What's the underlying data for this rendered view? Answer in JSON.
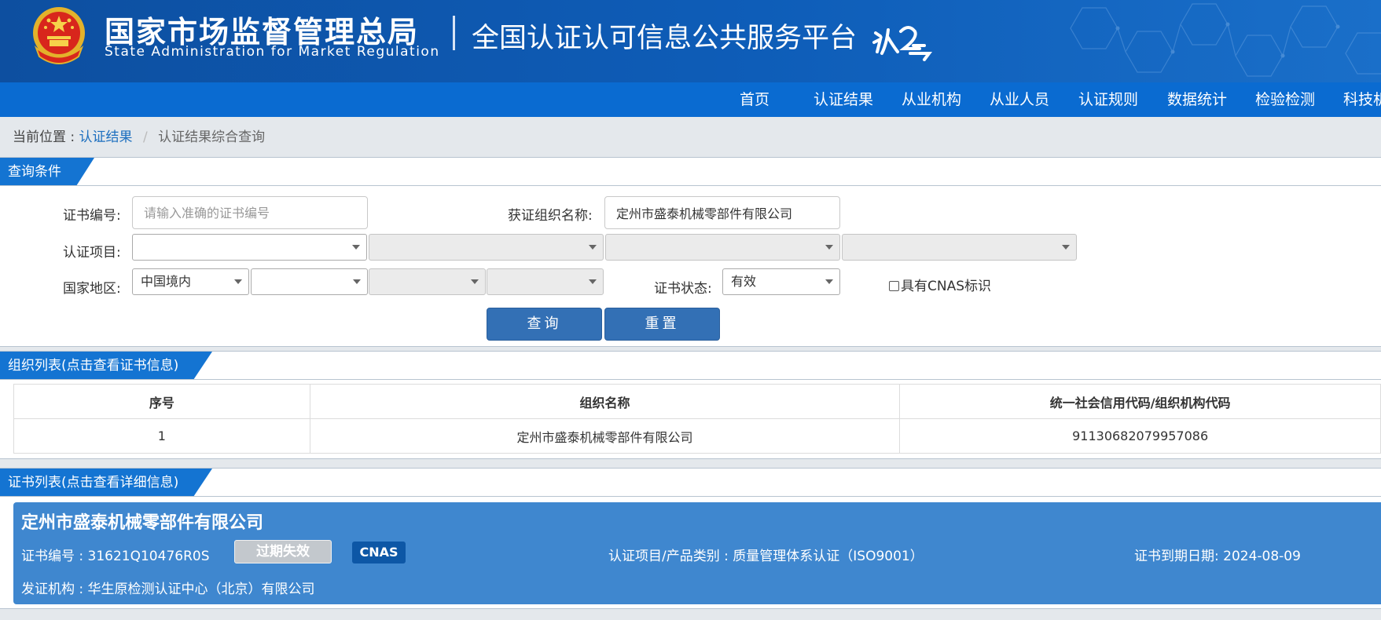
{
  "header": {
    "org_name_cn": "国家市场监督管理总局",
    "org_name_en": "State Administration  for  Market Regulation",
    "platform_title": "全国认证认可信息公共服务平台",
    "brand_color": "#0d4fa0"
  },
  "nav": {
    "items": [
      "首页",
      "认证结果",
      "从业机构",
      "从业人员",
      "认证规则",
      "数据统计",
      "检验检测",
      "科技机"
    ]
  },
  "breadcrumb": {
    "prefix": "当前位置 :",
    "link": "认证结果",
    "separator": "/",
    "current": "认证结果综合查询"
  },
  "query": {
    "title": "查询条件",
    "cert_no_label": "证书编号:",
    "cert_no_placeholder": "请输入准确的证书编号",
    "org_name_label": "获证组织名称:",
    "org_name_value": "定州市盛泰机械零部件有限公司",
    "project_label": "认证项目:",
    "region_label": "国家地区:",
    "region_value": "中国境内",
    "status_label": "证书状态:",
    "status_value": "有效",
    "cnas_label": "具有CNAS标识",
    "search_button": "查询",
    "reset_button": "重置"
  },
  "org_list": {
    "title": "组织列表(点击查看证书信息)",
    "columns": [
      "序号",
      "组织名称",
      "统一社会信用代码/组织机构代码"
    ],
    "rows": [
      [
        "1",
        "定州市盛泰机械零部件有限公司",
        "91130682079957086"
      ]
    ]
  },
  "cert_list": {
    "title": "证书列表(点击查看详细信息)",
    "card": {
      "org_name": "定州市盛泰机械零部件有限公司",
      "cert_no": "证书编号 : 31621Q10476R0S",
      "status_badge": "过期失效",
      "cnas_badge": "CNAS",
      "project": "认证项目/产品类别 : 质量管理体系认证（ISO9001）",
      "expiry": "证书到期日期: 2024-08-09",
      "issuer": "发证机构 : 华生原检测认证中心（北京）有限公司"
    }
  }
}
